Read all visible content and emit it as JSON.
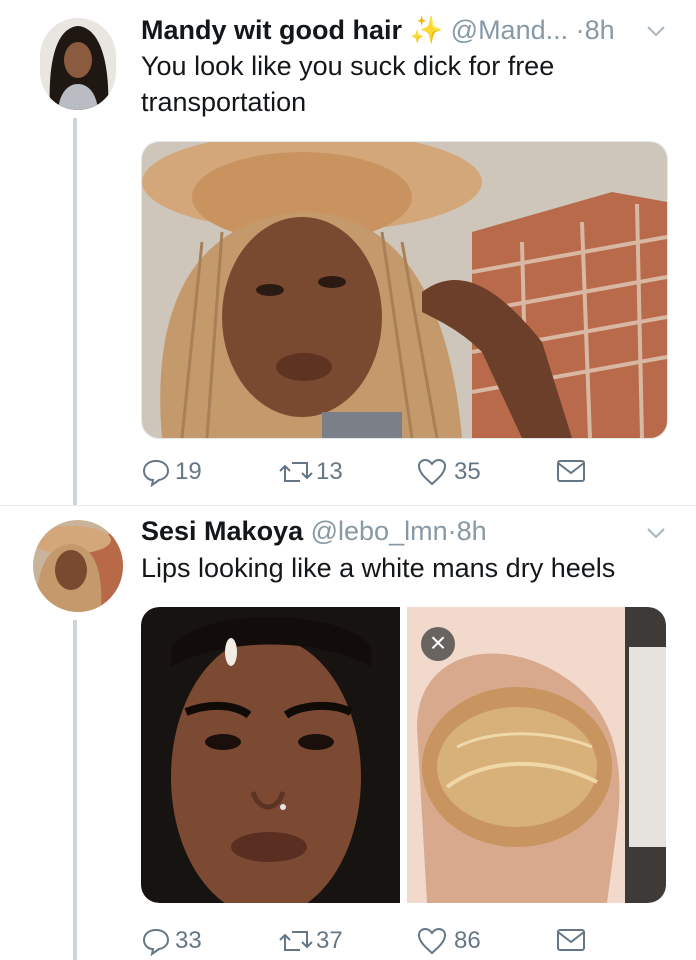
{
  "tweets": [
    {
      "name": "Mandy wit good hair",
      "name_emoji": "✨",
      "handle": "@Mand...",
      "time": "8h",
      "text": "You look like you suck dick for free transportation",
      "replies": "19",
      "retweets": "13",
      "likes": "35"
    },
    {
      "name": "Sesi Makoya",
      "handle": "@lebo_lmn",
      "time": "8h",
      "text": "Lips looking like a white mans dry heels",
      "replies": "33",
      "retweets": "37",
      "likes": "86"
    }
  ],
  "media_close_glyph": "×",
  "separator": "·",
  "colors": {
    "text": "#14171a",
    "secondary": "#8899a6",
    "thread_line": "#cdd5dc",
    "action_icon": "#657786"
  }
}
